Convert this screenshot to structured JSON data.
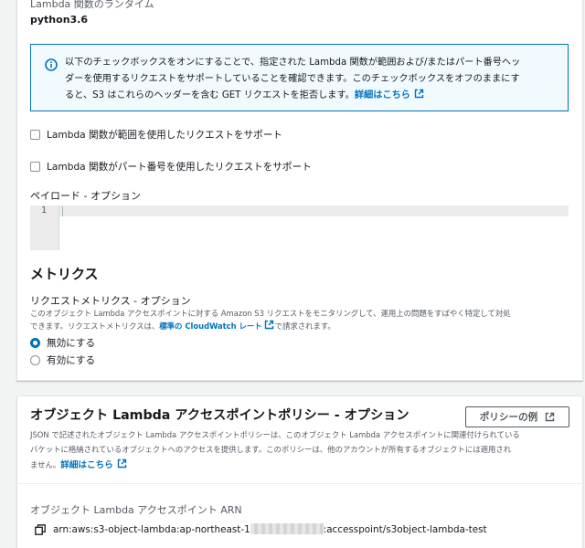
{
  "runtime": {
    "label": "Lambda 関数のランタイム",
    "value": "python3.6"
  },
  "info": {
    "line1": "以下のチェックボックスをオンにすることで、指定された Lambda 関数が範囲および/またはパート番号ヘッ",
    "line2": "ダーを使用するリクエストをサポートしていることを確認できます。このチェックボックスをオフのままにす",
    "line3": "ると、S3 はこれらのヘッダーを含む GET リクエストを拒否します。",
    "link": "詳細はこちら"
  },
  "checkboxes": {
    "range": "Lambda 関数が範囲を使用したリクエストをサポート",
    "part": "Lambda 関数がパート番号を使用したリクエストをサポート"
  },
  "payload": {
    "label": "ペイロード - オプション",
    "line_number": "1"
  },
  "metrics": {
    "heading": "メトリクス",
    "request_label": "リクエストメトリクス - オプション",
    "desc_line1": "このオブジェクト Lambda アクセスポイントに対する Amazon S3 リクエストをモニタリングして、運用上の問題をすばやく特定して対処",
    "desc_line2_prefix": "できます。リクエストメトリクスは、",
    "desc_link": "標準の CloudWatch レート",
    "desc_line2_suffix": "で請求されます。",
    "options": [
      "無効にする",
      "有効にする"
    ],
    "selected": "無効にする"
  },
  "policy": {
    "heading": "オブジェクト Lambda アクセスポイントポリシー - オプション",
    "example_button": "ポリシーの例",
    "desc_line1": "JSON で記述されたオブジェクト Lambda アクセスポイントポリシーは、このオブジェクト Lambda アクセスポイントに関連付けられている",
    "desc_line2": "バケットに格納されているオブジェクトへのアクセスを提供します。このポリシーは、他のアカウントが所有するオブジェクトには適用され",
    "desc_line3": "ません。",
    "link": "詳細はこちら"
  },
  "arn": {
    "label": "オブジェクト Lambda アクセスポイント ARN",
    "prefix": "arn:aws:s3-object-lambda:ap-northeast-1",
    "suffix": ":accesspoint/s3object-lambda-test"
  },
  "colors": {
    "link": "#0073bb",
    "info_bg": "#f1faff",
    "page_bg": "#f2f3f3"
  }
}
